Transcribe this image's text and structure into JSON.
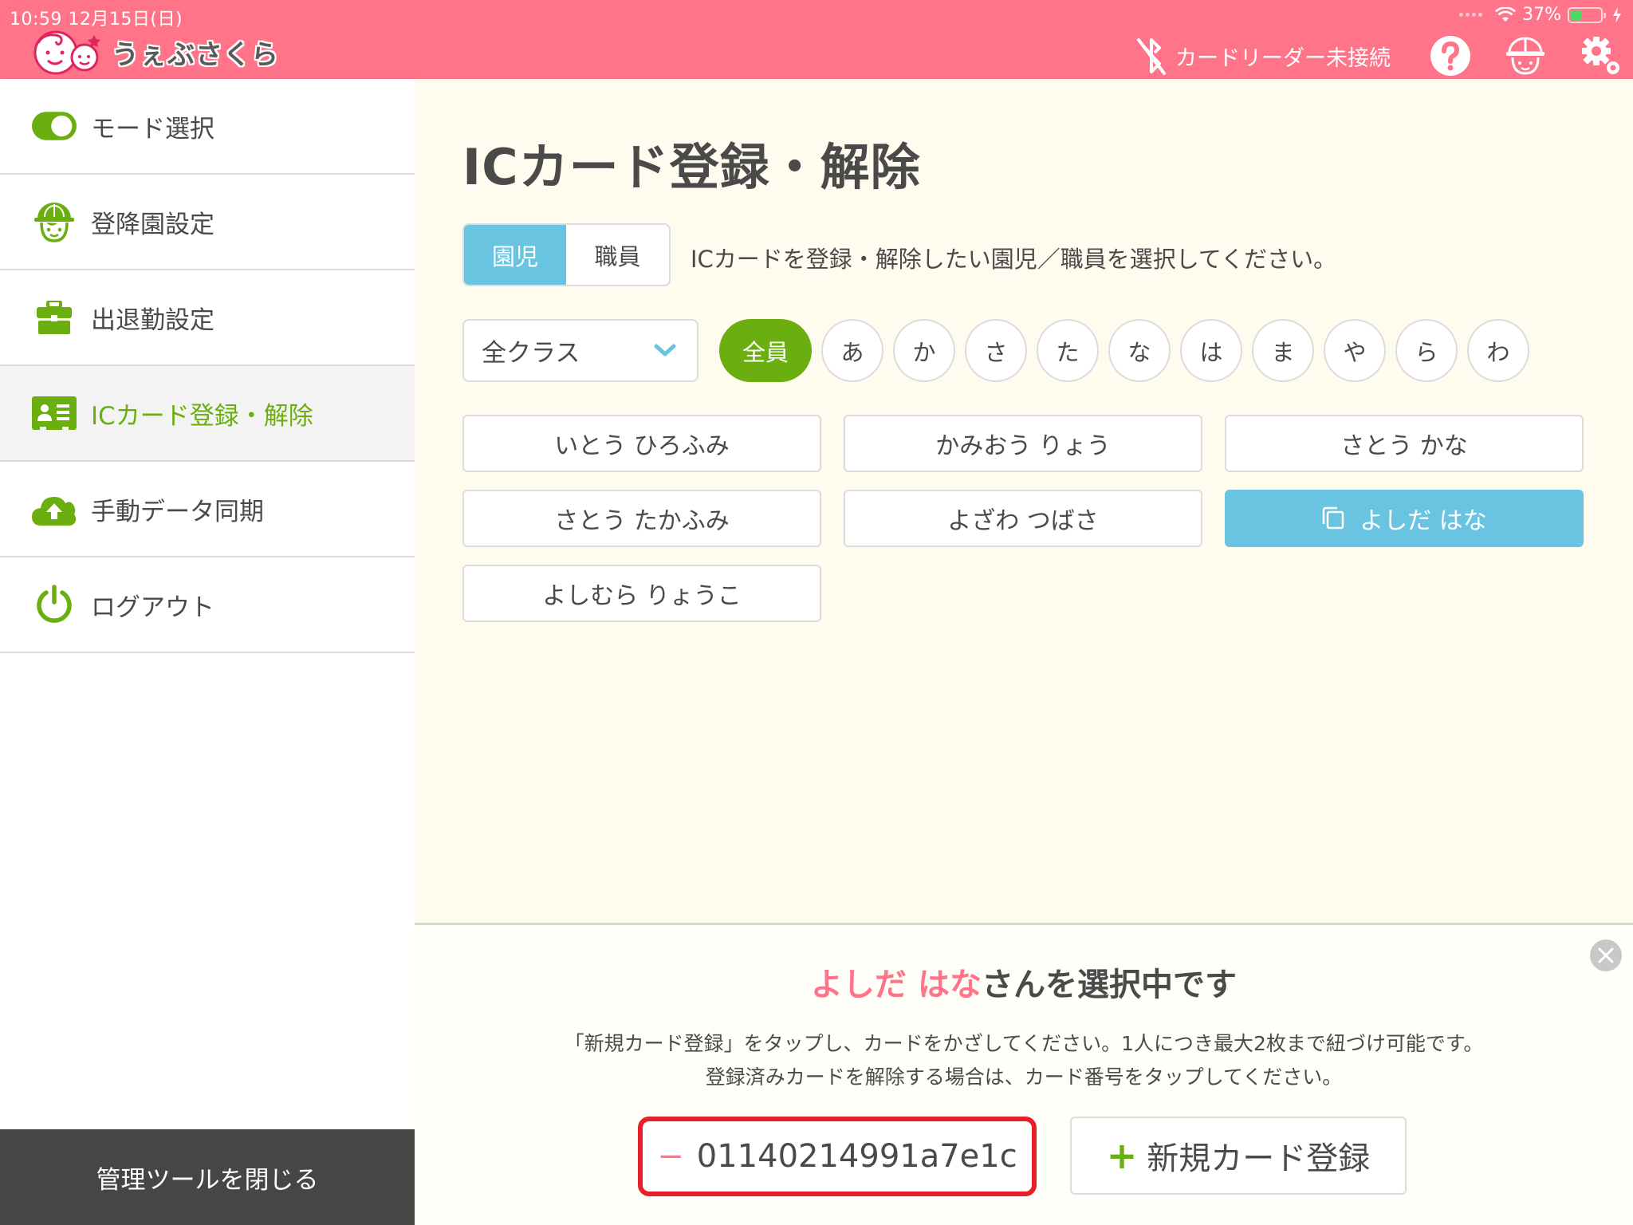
{
  "status_bar": {
    "time_date": "10:59   12月15日(日)",
    "battery_percent_label": "37%",
    "battery_level": 0.37
  },
  "header": {
    "app_name": "うぇぶさくら",
    "reader_status": "カードリーダー未接続",
    "icons": [
      "bluetooth-disabled-icon",
      "help-icon",
      "child-face-icon",
      "settings-gears-icon"
    ]
  },
  "sidebar": {
    "items": [
      {
        "label": "モード選択",
        "icon": "toggle-icon",
        "active": false
      },
      {
        "label": "登降園設定",
        "icon": "child-helmet-icon",
        "active": false
      },
      {
        "label": "出退勤設定",
        "icon": "briefcase-icon",
        "active": false
      },
      {
        "label": "ICカード登録・解除",
        "icon": "id-card-icon",
        "active": true
      },
      {
        "label": "手動データ同期",
        "icon": "cloud-upload-icon",
        "active": false
      },
      {
        "label": "ログアウト",
        "icon": "power-icon",
        "active": false
      }
    ],
    "close_label": "管理ツールを閉じる"
  },
  "main": {
    "title": "ICカード登録・解除",
    "segments": [
      {
        "label": "園児",
        "active": true
      },
      {
        "label": "職員",
        "active": false
      }
    ],
    "instruction": "ICカードを登録・解除したい園児／職員を選択してください。",
    "class_select": {
      "selected": "全クラス"
    },
    "kana_filters": [
      "全員",
      "あ",
      "か",
      "さ",
      "た",
      "な",
      "は",
      "ま",
      "や",
      "ら",
      "わ"
    ],
    "kana_active": "全員",
    "names": [
      {
        "name": "いとう ひろふみ",
        "selected": false
      },
      {
        "name": "かみおう りょう",
        "selected": false
      },
      {
        "name": "さとう かな",
        "selected": false
      },
      {
        "name": "さとう たかふみ",
        "selected": false
      },
      {
        "name": "よざわ つばさ",
        "selected": false
      },
      {
        "name": "よしだ はな",
        "selected": true
      },
      {
        "name": "よしむら りょうこ",
        "selected": false
      }
    ]
  },
  "panel": {
    "selected_name": "よしだ はな",
    "selected_suffix": "さんを選択中です",
    "desc_line1": "「新規カード登録」をタップし、カードをかざしてください。1人につき最大2枚まで紐づけ可能です。",
    "desc_line2": "登録済みカードを解除する場合は、カード番号をタップしてください。",
    "registered_card": "01140214991a7e1c",
    "minus_symbol": "−",
    "plus_symbol": "+",
    "new_card_label": "新規カード登録"
  },
  "colors": {
    "header_pink": "#ff7489",
    "accent_green": "#6aaf0f",
    "selected_blue": "#68c4e0",
    "highlight_red": "#e8202a",
    "main_bg": "#fffbee",
    "sidebar_footer": "#464646"
  }
}
